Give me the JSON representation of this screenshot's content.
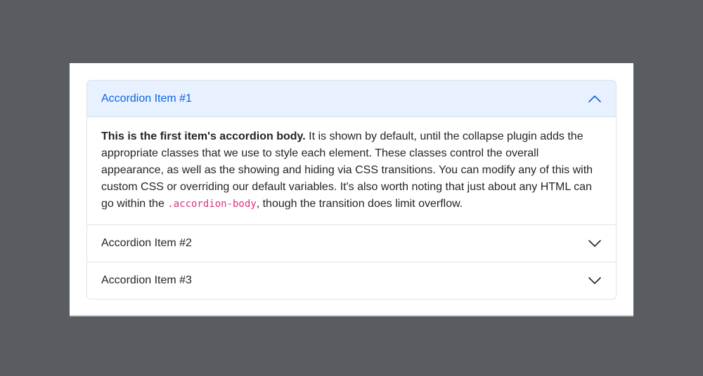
{
  "accordion": {
    "items": [
      {
        "label": "Accordion Item #1",
        "expanded": true,
        "body": {
          "strong": "This is the first item's accordion body.",
          "text_before_code": " It is shown by default, until the collapse plugin adds the appropriate classes that we use to style each element. These classes control the overall appearance, as well as the showing and hiding via CSS transitions. You can modify any of this with custom CSS or overriding our default variables. It's also worth noting that just about any HTML can go within the ",
          "code": ".accordion-body",
          "text_after_code": ", though the transition does limit overflow."
        }
      },
      {
        "label": "Accordion Item #2",
        "expanded": false
      },
      {
        "label": "Accordion Item #3",
        "expanded": false
      }
    ]
  },
  "colors": {
    "backdrop": "#595d61",
    "active_header_bg": "#e7f1ff",
    "active_header_text": "#0c63e4",
    "code_text": "#d63384"
  },
  "icons": {
    "expanded": "chevron-up-icon",
    "collapsed": "chevron-down-icon"
  }
}
